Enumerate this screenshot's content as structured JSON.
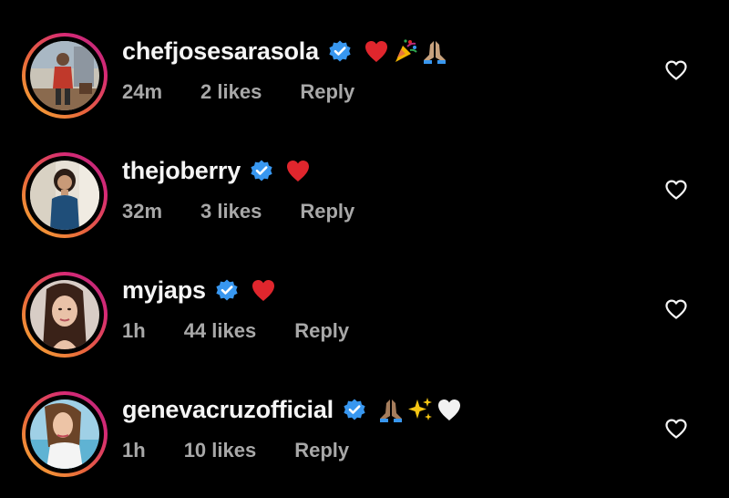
{
  "colors": {
    "background": "#000000",
    "username_text": "#f5f5f5",
    "meta_text": "#a8a8a8",
    "verified_badge": "#3897f0",
    "story_ring_gradient": [
      "#f9b233",
      "#e8643c",
      "#d62976",
      "#b42a7a"
    ]
  },
  "comments": [
    {
      "username": "chefjosesarasola",
      "verified": true,
      "text_emojis": [
        "red-heart",
        "party-popper",
        "folded-hands"
      ],
      "time": "24m",
      "likes": "2 likes",
      "reply_label": "Reply",
      "like_icon": "heart-outline-icon"
    },
    {
      "username": "thejoberry",
      "verified": true,
      "text_emojis": [
        "red-heart"
      ],
      "time": "32m",
      "likes": "3 likes",
      "reply_label": "Reply",
      "like_icon": "heart-outline-icon"
    },
    {
      "username": "myjaps",
      "verified": true,
      "text_emojis": [
        "red-heart"
      ],
      "time": "1h",
      "likes": "44 likes",
      "reply_label": "Reply",
      "like_icon": "heart-outline-icon"
    },
    {
      "username": "genevacruzofficial",
      "verified": true,
      "text_emojis": [
        "folded-hands",
        "sparkles",
        "white-heart"
      ],
      "time": "1h",
      "likes": "10 likes",
      "reply_label": "Reply",
      "like_icon": "heart-outline-icon"
    }
  ]
}
